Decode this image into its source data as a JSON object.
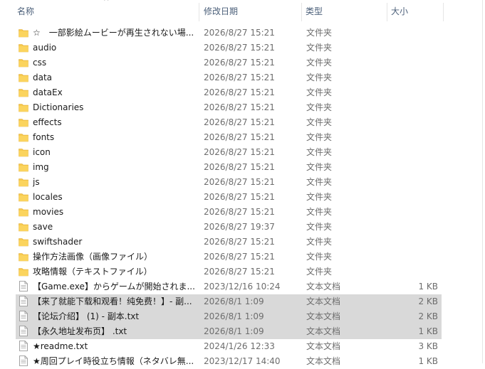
{
  "columns": {
    "name": "名称",
    "date": "修改日期",
    "type": "类型",
    "size": "大小"
  },
  "colors": {
    "folder": "#f7ca4e",
    "selected": "#d9d9d9",
    "header_text": "#4c607a"
  },
  "files": [
    {
      "kind": "folder",
      "name": "☆　一部影絵ムービーが再生されない場...",
      "date": "2026/8/27 15:21",
      "type": "文件夹",
      "size": "",
      "selected": false
    },
    {
      "kind": "folder",
      "name": "audio",
      "date": "2026/8/27 15:21",
      "type": "文件夹",
      "size": "",
      "selected": false
    },
    {
      "kind": "folder",
      "name": "css",
      "date": "2026/8/27 15:21",
      "type": "文件夹",
      "size": "",
      "selected": false
    },
    {
      "kind": "folder",
      "name": "data",
      "date": "2026/8/27 15:21",
      "type": "文件夹",
      "size": "",
      "selected": false
    },
    {
      "kind": "folder",
      "name": "dataEx",
      "date": "2026/8/27 15:21",
      "type": "文件夹",
      "size": "",
      "selected": false
    },
    {
      "kind": "folder",
      "name": "Dictionaries",
      "date": "2026/8/27 15:21",
      "type": "文件夹",
      "size": "",
      "selected": false
    },
    {
      "kind": "folder",
      "name": "effects",
      "date": "2026/8/27 15:21",
      "type": "文件夹",
      "size": "",
      "selected": false
    },
    {
      "kind": "folder",
      "name": "fonts",
      "date": "2026/8/27 15:21",
      "type": "文件夹",
      "size": "",
      "selected": false
    },
    {
      "kind": "folder",
      "name": "icon",
      "date": "2026/8/27 15:21",
      "type": "文件夹",
      "size": "",
      "selected": false
    },
    {
      "kind": "folder",
      "name": "img",
      "date": "2026/8/27 15:21",
      "type": "文件夹",
      "size": "",
      "selected": false
    },
    {
      "kind": "folder",
      "name": "js",
      "date": "2026/8/27 15:21",
      "type": "文件夹",
      "size": "",
      "selected": false
    },
    {
      "kind": "folder",
      "name": "locales",
      "date": "2026/8/27 15:21",
      "type": "文件夹",
      "size": "",
      "selected": false
    },
    {
      "kind": "folder",
      "name": "movies",
      "date": "2026/8/27 15:21",
      "type": "文件夹",
      "size": "",
      "selected": false
    },
    {
      "kind": "folder",
      "name": "save",
      "date": "2026/8/27 19:37",
      "type": "文件夹",
      "size": "",
      "selected": false
    },
    {
      "kind": "folder",
      "name": "swiftshader",
      "date": "2026/8/27 15:21",
      "type": "文件夹",
      "size": "",
      "selected": false
    },
    {
      "kind": "folder",
      "name": "操作方法画像（画像ファイル）",
      "date": "2026/8/27 15:21",
      "type": "文件夹",
      "size": "",
      "selected": false
    },
    {
      "kind": "folder",
      "name": "攻略情報（テキストファイル）",
      "date": "2026/8/27 15:21",
      "type": "文件夹",
      "size": "",
      "selected": false
    },
    {
      "kind": "file",
      "name": "【Game.exe】からゲームが開始されま...",
      "date": "2023/12/16 10:24",
      "type": "文本文档",
      "size": "1 KB",
      "selected": false
    },
    {
      "kind": "file",
      "name": "【来了就能下载和观看！纯免费！】- 副...",
      "date": "2026/8/1 1:09",
      "type": "文本文档",
      "size": "2 KB",
      "selected": true
    },
    {
      "kind": "file",
      "name": "【论坛介绍】 (1) - 副本.txt",
      "date": "2026/8/1 1:09",
      "type": "文本文档",
      "size": "2 KB",
      "selected": true
    },
    {
      "kind": "file",
      "name": "【永久地址发布页】 .txt",
      "date": "2026/8/1 1:09",
      "type": "文本文档",
      "size": "1 KB",
      "selected": true
    },
    {
      "kind": "file",
      "name": "★readme.txt",
      "date": "2024/1/26 12:33",
      "type": "文本文档",
      "size": "3 KB",
      "selected": false
    },
    {
      "kind": "file",
      "name": "★周回プレイ時役立ち情報（ネタバレ無...",
      "date": "2023/12/17 14:40",
      "type": "文本文档",
      "size": "1 KB",
      "selected": false
    }
  ]
}
